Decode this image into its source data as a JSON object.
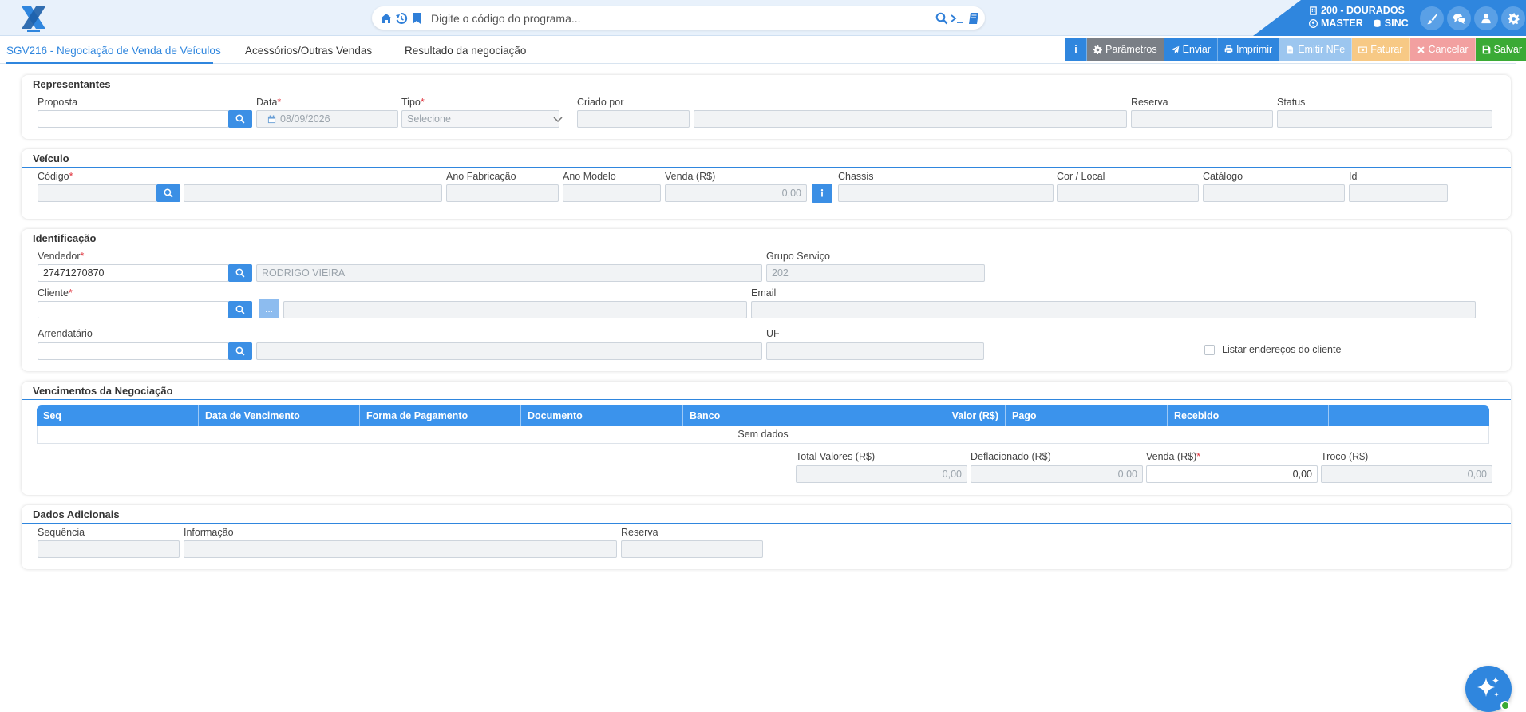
{
  "header": {
    "search_placeholder": "Digite o código do programa...",
    "unit": "200 - DOURADOS",
    "user": "MASTER",
    "sync": "SINC"
  },
  "tabs": [
    {
      "label": "SGV216 - Negociação de Venda de Veículos",
      "active": true
    },
    {
      "label": "Acessórios/Outras Vendas",
      "active": false
    },
    {
      "label": "Resultado da negociação",
      "active": false
    }
  ],
  "toolbar": {
    "info": "i",
    "parametros": "Parâmetros",
    "enviar": "Enviar",
    "imprimir": "Imprimir",
    "emitir_nfe": "Emitir NFe",
    "faturar": "Faturar",
    "cancelar": "Cancelar",
    "salvar": "Salvar",
    "colors": {
      "info": "#2f86de",
      "parametros": "#7a7f86",
      "primary": "#2f86de",
      "disabled_blue": "#9cc6ef",
      "disabled_orange": "#f7c985",
      "disabled_red": "#f2a0a0",
      "salvar": "#3aaa35"
    }
  },
  "representantes": {
    "title": "Representantes",
    "proposta_label": "Proposta",
    "data_label": "Data",
    "data_value": "08/09/2026",
    "tipo_label": "Tipo",
    "tipo_value": "Selecione",
    "criado_por_label": "Criado por",
    "reserva_label": "Reserva",
    "status_label": "Status"
  },
  "veiculo": {
    "title": "Veículo",
    "codigo_label": "Código",
    "ano_fabricacao_label": "Ano Fabricação",
    "ano_modelo_label": "Ano Modelo",
    "venda_label": "Venda (R$)",
    "venda_value": "0,00",
    "chassis_label": "Chassis",
    "cor_local_label": "Cor / Local",
    "catalogo_label": "Catálogo",
    "id_label": "Id"
  },
  "identificacao": {
    "title": "Identificação",
    "vendedor_label": "Vendedor",
    "vendedor_value": "27471270870",
    "vendedor_nome": "RODRIGO VIEIRA",
    "grupo_servico_label": "Grupo Serviço",
    "grupo_servico_value": "202",
    "cliente_label": "Cliente",
    "cliente_more": "...",
    "email_label": "Email",
    "arrendatario_label": "Arrendatário",
    "uf_label": "UF",
    "listar_enderecos_label": "Listar endereços do cliente"
  },
  "vencimentos": {
    "title": "Vencimentos da Negociação",
    "columns": [
      "Seq",
      "Data de Vencimento",
      "Forma de Pagamento",
      "Documento",
      "Banco",
      "Valor (R$)",
      "Pago",
      "Recebido",
      ""
    ],
    "empty_text": "Sem dados",
    "total_valores_label": "Total Valores (R$)",
    "total_valores_value": "0,00",
    "deflacionado_label": "Deflacionado (R$)",
    "deflacionado_value": "0,00",
    "venda_label": "Venda (R$)",
    "venda_value": "0,00",
    "troco_label": "Troco (R$)",
    "troco_value": "0,00"
  },
  "dados_adicionais": {
    "title": "Dados Adicionais",
    "sequencia_label": "Sequência",
    "informacao_label": "Informação",
    "reserva_label": "Reserva"
  }
}
